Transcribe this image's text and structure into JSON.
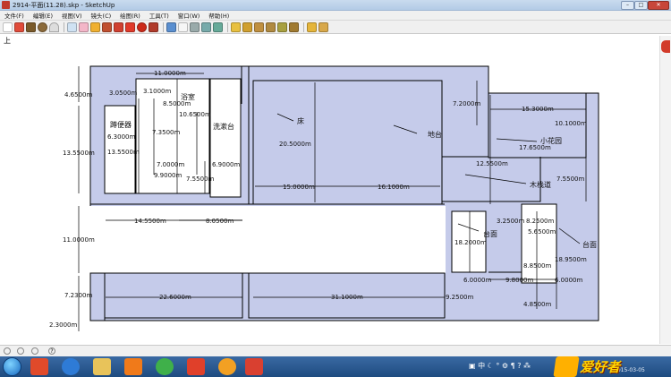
{
  "window": {
    "title": "2914-平面(11.28).skp - SketchUp"
  },
  "menu": [
    "文件(F)",
    "编辑(E)",
    "视图(V)",
    "镜头(C)",
    "绘图(R)",
    "工具(T)",
    "窗口(W)",
    "帮助(H)"
  ],
  "toolbar_icons": [
    "select-icon",
    "line-icon",
    "rectangle-icon",
    "circle-icon",
    "arc-icon",
    "make-component-icon",
    "eraser-icon",
    "paint-bucket-icon",
    "push-pull-icon",
    "follow-me-icon",
    "move-icon",
    "rotate-icon",
    "offset-icon",
    "orbit-icon",
    "pan-icon",
    "zoom-icon",
    "zoom-window-icon",
    "zoom-extents-icon",
    "iso-view-icon",
    "top-view-icon",
    "front-view-icon",
    "right-view-icon",
    "back-view-icon",
    "left-view-icon",
    "get-models-icon",
    "share-model-icon"
  ],
  "canvas": {
    "view_label": "上",
    "room_labels": {
      "bathroom": "蹲便器",
      "shower": "浴室",
      "washbasin": "洗漱台",
      "bed": "床",
      "platform": "地台",
      "small_garden": "小花园",
      "wood_corridor": "木栈道",
      "stage_a": "台面",
      "stage_b": "台面"
    },
    "dimensions": {
      "d01": "11.0000m",
      "d02": "4.6500m",
      "d03": "3.0500m",
      "d04": "3.1000m",
      "d05": "8.5000m",
      "d06": "10.6500m",
      "d07": "7.3500m",
      "d08": "6.3000m",
      "d09": "13.5500m",
      "d10": "13.5500m",
      "d11": "7.0000m",
      "d12": "6.9000m",
      "d13": "7.5500m",
      "d14": "9.9000m",
      "d15": "14.5500m",
      "d16": "8.0500m",
      "d17": "11.0000m",
      "d18": "7.2300m",
      "d19": "22.6000m",
      "d20": "31.1000m",
      "d21": "2.3000m",
      "d22": "20.5000m",
      "d23": "15.0000m",
      "d24": "16.1000m",
      "d25": "7.2000m",
      "d26": "15.3000m",
      "d27": "10.1000m",
      "d28": "17.6500m",
      "d29": "12.5500m",
      "d30": "7.5500m",
      "d31": "3.2500m",
      "d32": "8.2500m",
      "d33": "5.6500m",
      "d34": "18.2000m",
      "d35": "18.9500m",
      "d36": "8.8500m",
      "d37": "6.0000m",
      "d38": "9.8000m",
      "d39": "6.0000m",
      "d40": "4.8500m",
      "d41": "9.2500m"
    }
  },
  "status": {
    "clock": "2015-03-05"
  },
  "colors": {
    "floor": "#c5cbea",
    "wall_line": "#000000",
    "canvas": "#ffffff"
  }
}
